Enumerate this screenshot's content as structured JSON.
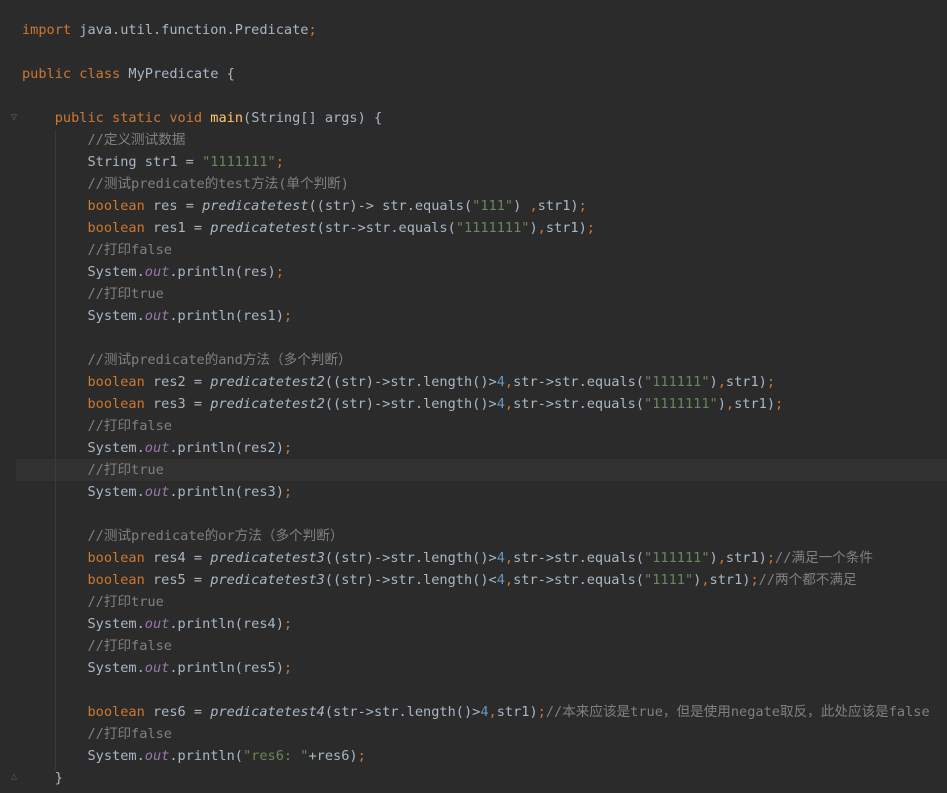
{
  "colors": {
    "background": "#2b2b2b",
    "current_line": "#323232",
    "default_text": "#a9b7c6",
    "keyword": "#cc7832",
    "string": "#6a8759",
    "number": "#6897bb",
    "comment": "#808080",
    "method_decl": "#ffc66d",
    "static_field": "#9876aa"
  },
  "icons": {
    "fold_method": "fold-marker-icon",
    "fold_end": "fold-end-marker-icon"
  },
  "code": {
    "lines": [
      [
        {
          "t": "import",
          "c": "kw"
        },
        {
          "t": " java.util.function.Predicate"
        },
        {
          "t": ";",
          "c": "kw"
        }
      ],
      [],
      [
        {
          "t": "public class",
          "c": "kw"
        },
        {
          "t": " MyPredicate {"
        }
      ],
      [],
      [
        {
          "t": "    "
        },
        {
          "t": "public static void",
          "c": "kw"
        },
        {
          "t": " "
        },
        {
          "t": "main",
          "c": "fn"
        },
        {
          "t": "(String[] args) {"
        }
      ],
      [
        {
          "t": "        "
        },
        {
          "t": "//定义测试数据",
          "c": "cm"
        }
      ],
      [
        {
          "t": "        String str1 = "
        },
        {
          "t": "\"1111111\"",
          "c": "str"
        },
        {
          "t": ";",
          "c": "kw"
        }
      ],
      [
        {
          "t": "        "
        },
        {
          "t": "//测试predicate的test方法(单个判断)",
          "c": "cm"
        }
      ],
      [
        {
          "t": "        "
        },
        {
          "t": "boolean",
          "c": "kw"
        },
        {
          "t": " res = "
        },
        {
          "t": "predicatetest",
          "c": "it"
        },
        {
          "t": "((str)-> str.equals("
        },
        {
          "t": "\"111\"",
          "c": "str"
        },
        {
          "t": ") "
        },
        {
          "t": ",",
          "c": "kw"
        },
        {
          "t": "str1)"
        },
        {
          "t": ";",
          "c": "kw"
        }
      ],
      [
        {
          "t": "        "
        },
        {
          "t": "boolean",
          "c": "kw"
        },
        {
          "t": " res1 = "
        },
        {
          "t": "predicatetest",
          "c": "it"
        },
        {
          "t": "(str->str.equals("
        },
        {
          "t": "\"1111111\"",
          "c": "str"
        },
        {
          "t": ")"
        },
        {
          "t": ",",
          "c": "kw"
        },
        {
          "t": "str1)"
        },
        {
          "t": ";",
          "c": "kw"
        }
      ],
      [
        {
          "t": "        "
        },
        {
          "t": "//打印false",
          "c": "cm"
        }
      ],
      [
        {
          "t": "        System."
        },
        {
          "t": "out",
          "c": "fld"
        },
        {
          "t": ".println(res)"
        },
        {
          "t": ";",
          "c": "kw"
        }
      ],
      [
        {
          "t": "        "
        },
        {
          "t": "//打印true",
          "c": "cm"
        }
      ],
      [
        {
          "t": "        System."
        },
        {
          "t": "out",
          "c": "fld"
        },
        {
          "t": ".println(res1)"
        },
        {
          "t": ";",
          "c": "kw"
        }
      ],
      [],
      [
        {
          "t": "        "
        },
        {
          "t": "//测试predicate的and方法（多个判断）",
          "c": "cm"
        }
      ],
      [
        {
          "t": "        "
        },
        {
          "t": "boolean",
          "c": "kw"
        },
        {
          "t": " res2 = "
        },
        {
          "t": "predicatetest2",
          "c": "it"
        },
        {
          "t": "((str)->str.length()>"
        },
        {
          "t": "4",
          "c": "num"
        },
        {
          "t": ",",
          "c": "kw"
        },
        {
          "t": "str->str.equals("
        },
        {
          "t": "\"111111\"",
          "c": "str"
        },
        {
          "t": ")"
        },
        {
          "t": ",",
          "c": "kw"
        },
        {
          "t": "str1)"
        },
        {
          "t": ";",
          "c": "kw"
        }
      ],
      [
        {
          "t": "        "
        },
        {
          "t": "boolean",
          "c": "kw"
        },
        {
          "t": " res3 = "
        },
        {
          "t": "predicatetest2",
          "c": "it"
        },
        {
          "t": "((str)->str.length()>"
        },
        {
          "t": "4",
          "c": "num"
        },
        {
          "t": ",",
          "c": "kw"
        },
        {
          "t": "str->str.equals("
        },
        {
          "t": "\"1111111\"",
          "c": "str"
        },
        {
          "t": ")"
        },
        {
          "t": ",",
          "c": "kw"
        },
        {
          "t": "str1)"
        },
        {
          "t": ";",
          "c": "kw"
        }
      ],
      [
        {
          "t": "        "
        },
        {
          "t": "//打印false",
          "c": "cm"
        }
      ],
      [
        {
          "t": "        System."
        },
        {
          "t": "out",
          "c": "fld"
        },
        {
          "t": ".println(res2)"
        },
        {
          "t": ";",
          "c": "kw"
        }
      ],
      [
        {
          "t": "        "
        },
        {
          "t": "//打印true",
          "c": "cm"
        }
      ],
      [
        {
          "t": "        System."
        },
        {
          "t": "out",
          "c": "fld"
        },
        {
          "t": ".println(res3)"
        },
        {
          "t": ";",
          "c": "kw"
        }
      ],
      [],
      [
        {
          "t": "        "
        },
        {
          "t": "//测试predicate的or方法（多个判断）",
          "c": "cm"
        }
      ],
      [
        {
          "t": "        "
        },
        {
          "t": "boolean",
          "c": "kw"
        },
        {
          "t": " res4 = "
        },
        {
          "t": "predicatetest3",
          "c": "it"
        },
        {
          "t": "((str)->str.length()>"
        },
        {
          "t": "4",
          "c": "num"
        },
        {
          "t": ",",
          "c": "kw"
        },
        {
          "t": "str->str.equals("
        },
        {
          "t": "\"111111\"",
          "c": "str"
        },
        {
          "t": ")"
        },
        {
          "t": ",",
          "c": "kw"
        },
        {
          "t": "str1)"
        },
        {
          "t": ";",
          "c": "kw"
        },
        {
          "t": "//满足一个条件",
          "c": "cm"
        }
      ],
      [
        {
          "t": "        "
        },
        {
          "t": "boolean",
          "c": "kw"
        },
        {
          "t": " res5 = "
        },
        {
          "t": "predicatetest3",
          "c": "it"
        },
        {
          "t": "((str)->str.length()<"
        },
        {
          "t": "4",
          "c": "num"
        },
        {
          "t": ",",
          "c": "kw"
        },
        {
          "t": "str->str.equals("
        },
        {
          "t": "\"1111\"",
          "c": "str"
        },
        {
          "t": ")"
        },
        {
          "t": ",",
          "c": "kw"
        },
        {
          "t": "str1)"
        },
        {
          "t": ";",
          "c": "kw"
        },
        {
          "t": "//两个都不满足",
          "c": "cm"
        }
      ],
      [
        {
          "t": "        "
        },
        {
          "t": "//打印true",
          "c": "cm"
        }
      ],
      [
        {
          "t": "        System."
        },
        {
          "t": "out",
          "c": "fld"
        },
        {
          "t": ".println(res4)"
        },
        {
          "t": ";",
          "c": "kw"
        }
      ],
      [
        {
          "t": "        "
        },
        {
          "t": "//打印false",
          "c": "cm"
        }
      ],
      [
        {
          "t": "        System."
        },
        {
          "t": "out",
          "c": "fld"
        },
        {
          "t": ".println(res5)"
        },
        {
          "t": ";",
          "c": "kw"
        }
      ],
      [],
      [
        {
          "t": "        "
        },
        {
          "t": "boolean",
          "c": "kw"
        },
        {
          "t": " res6 = "
        },
        {
          "t": "predicatetest4",
          "c": "it"
        },
        {
          "t": "(str->str.length()>"
        },
        {
          "t": "4",
          "c": "num"
        },
        {
          "t": ",",
          "c": "kw"
        },
        {
          "t": "str1)"
        },
        {
          "t": ";",
          "c": "kw"
        },
        {
          "t": "//本来应该是true，但是使用negate取反，此处应该是false",
          "c": "cm"
        }
      ],
      [
        {
          "t": "        "
        },
        {
          "t": "//打印false",
          "c": "cm"
        }
      ],
      [
        {
          "t": "        System."
        },
        {
          "t": "out",
          "c": "fld"
        },
        {
          "t": ".println("
        },
        {
          "t": "\"res6: \"",
          "c": "str"
        },
        {
          "t": "+res6)"
        },
        {
          "t": ";",
          "c": "kw"
        }
      ],
      [
        {
          "t": "    }"
        }
      ]
    ]
  }
}
